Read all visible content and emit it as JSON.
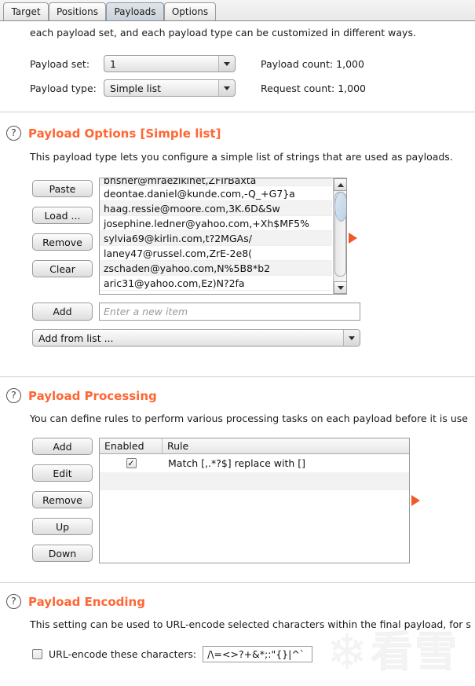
{
  "tabs": [
    {
      "label": "Target",
      "active": false
    },
    {
      "label": "Positions",
      "active": false
    },
    {
      "label": "Payloads",
      "active": true
    },
    {
      "label": "Options",
      "active": false
    }
  ],
  "intro": {
    "text": "each payload set, and each payload type can be customized in different ways."
  },
  "payload_set": {
    "label": "Payload set:",
    "value": "1",
    "count_label": "Payload count: 1,000"
  },
  "payload_type": {
    "label": "Payload type:",
    "value": "Simple list",
    "count_label": "Request count: 1,000"
  },
  "payload_options": {
    "icon": "help-circle-icon",
    "title": "Payload Options [Simple list]",
    "description": "This payload type lets you configure a simple list of strings that are used as payloads.",
    "buttons": [
      "Paste",
      "Load ...",
      "Remove",
      "Clear"
    ],
    "items": [
      "bnsher@mraezikinet,ZFIrBaxta",
      "deontae.daniel@kunde.com,-Q_+G7}a",
      "haag.ressie@moore.com,3K.6D&Sw",
      "josephine.ledner@yahoo.com,+Xh$MF5%",
      "sylvia69@kirlin.com,t?2MGAs/",
      "laney47@russel.com,ZrE-2e8(",
      "zschaden@yahoo.com,N%5B8*b2",
      "aric31@yahoo.com,Ez)N?2fa"
    ],
    "add_button": "Add",
    "add_placeholder": "Enter a new item",
    "add_from_list": "Add from list ..."
  },
  "payload_processing": {
    "icon": "help-circle-icon",
    "title": "Payload Processing",
    "description": "You can define rules to perform various processing tasks on each payload before it is use",
    "buttons": [
      "Add",
      "Edit",
      "Remove",
      "Up",
      "Down"
    ],
    "columns": [
      "Enabled",
      "Rule"
    ],
    "rows": [
      {
        "enabled": true,
        "check_glyph": "✓",
        "rule": "Match [,.*?$] replace with []"
      }
    ]
  },
  "payload_encoding": {
    "icon": "help-circle-icon",
    "title": "Payload Encoding",
    "description": "This setting can be used to URL-encode selected characters within the final payload, for s",
    "checkbox_checked": false,
    "checkbox_label": "URL-encode these characters:",
    "characters": "/\\=<>?+&*;:\"{}|^`"
  },
  "watermark": {
    "flake": "❄",
    "text": "看雪"
  },
  "colors": {
    "accent": "#ff6633",
    "marker": "#f05a28",
    "tab_active": "#c9d2da"
  }
}
